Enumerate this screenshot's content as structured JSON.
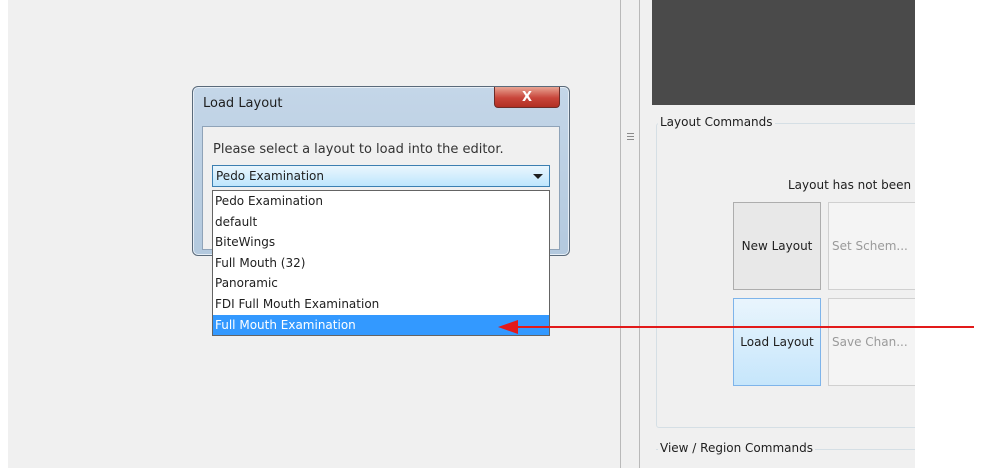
{
  "dialog": {
    "title": "Load Layout",
    "close_label": "X",
    "prompt": "Please select a layout to load into the editor.",
    "selected_value": "Pedo Examination",
    "options": [
      "Pedo Examination",
      "default",
      "BiteWings",
      "Full Mouth (32)",
      "Panoramic",
      "FDI Full Mouth Examination",
      "Full Mouth Examination"
    ],
    "highlighted_option": "Full Mouth Examination"
  },
  "right_panel": {
    "layout_commands_title": "Layout Commands",
    "status_text": "Layout has not been",
    "buttons": {
      "new_layout": "New Layout",
      "set_schema": "Set Schem...",
      "load_layout": "Load Layout",
      "save_changes": "Save Chan..."
    },
    "view_region_title": "View / Region Commands"
  },
  "colors": {
    "annotation_arrow": "#e21a1a",
    "selection": "#3399ff",
    "close_button": "#c8453a"
  },
  "icons": {
    "close": "close-icon",
    "dropdown": "chevron-down-icon",
    "splitter": "grip-icon",
    "annotation": "red-arrow-icon"
  }
}
